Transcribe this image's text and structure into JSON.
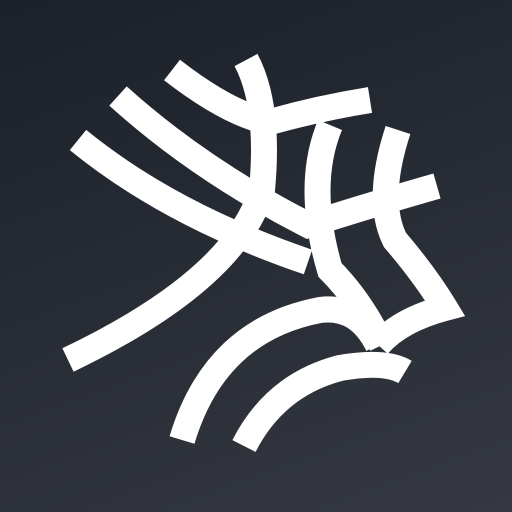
{
  "icon": {
    "name": "web-logo-icon",
    "background_top": "#1b2029",
    "background_bottom": "#353840",
    "foreground": "#ffffff"
  }
}
